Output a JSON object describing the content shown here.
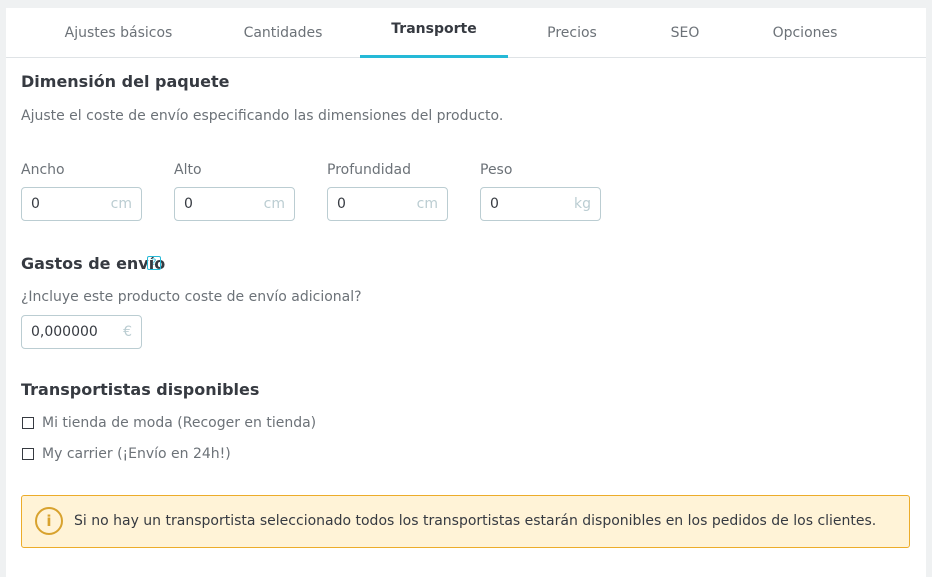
{
  "tabs": [
    {
      "label": "Ajustes básicos",
      "active": false
    },
    {
      "label": "Cantidades",
      "active": false
    },
    {
      "label": "Transporte",
      "active": true
    },
    {
      "label": "Precios",
      "active": false
    },
    {
      "label": "SEO",
      "active": false
    },
    {
      "label": "Opciones",
      "active": false
    }
  ],
  "package": {
    "title": "Dimensión del paquete",
    "description": "Ajuste el coste de envío especificando las dimensiones del producto.",
    "fields": [
      {
        "label": "Ancho",
        "value": "0",
        "unit": "cm"
      },
      {
        "label": "Alto",
        "value": "0",
        "unit": "cm"
      },
      {
        "label": "Profundidad",
        "value": "0",
        "unit": "cm"
      },
      {
        "label": "Peso",
        "value": "0",
        "unit": "kg"
      }
    ]
  },
  "shipping": {
    "title": "Gastos de envío",
    "help_icon": "question-icon",
    "help_glyph": "?",
    "question": "¿Incluye este producto coste de envío adicional?",
    "value": "0,000000",
    "unit": "€"
  },
  "carriers": {
    "title": "Transportistas disponibles",
    "items": [
      {
        "label": "Mi tienda de moda (Recoger en tienda)",
        "checked": false
      },
      {
        "label": "My carrier (¡Envío en 24h!)",
        "checked": false
      }
    ]
  },
  "alert": {
    "icon": "info-icon",
    "glyph": "i",
    "text": "Si no hay un transportista seleccionado todos los transportistas estarán disponibles en los pedidos de los clientes.",
    "background": "#fff3d7",
    "border": "#ecac2a"
  },
  "colors": {
    "accent": "#25b9d7",
    "text": "#363a41",
    "muted": "#6c7278"
  }
}
